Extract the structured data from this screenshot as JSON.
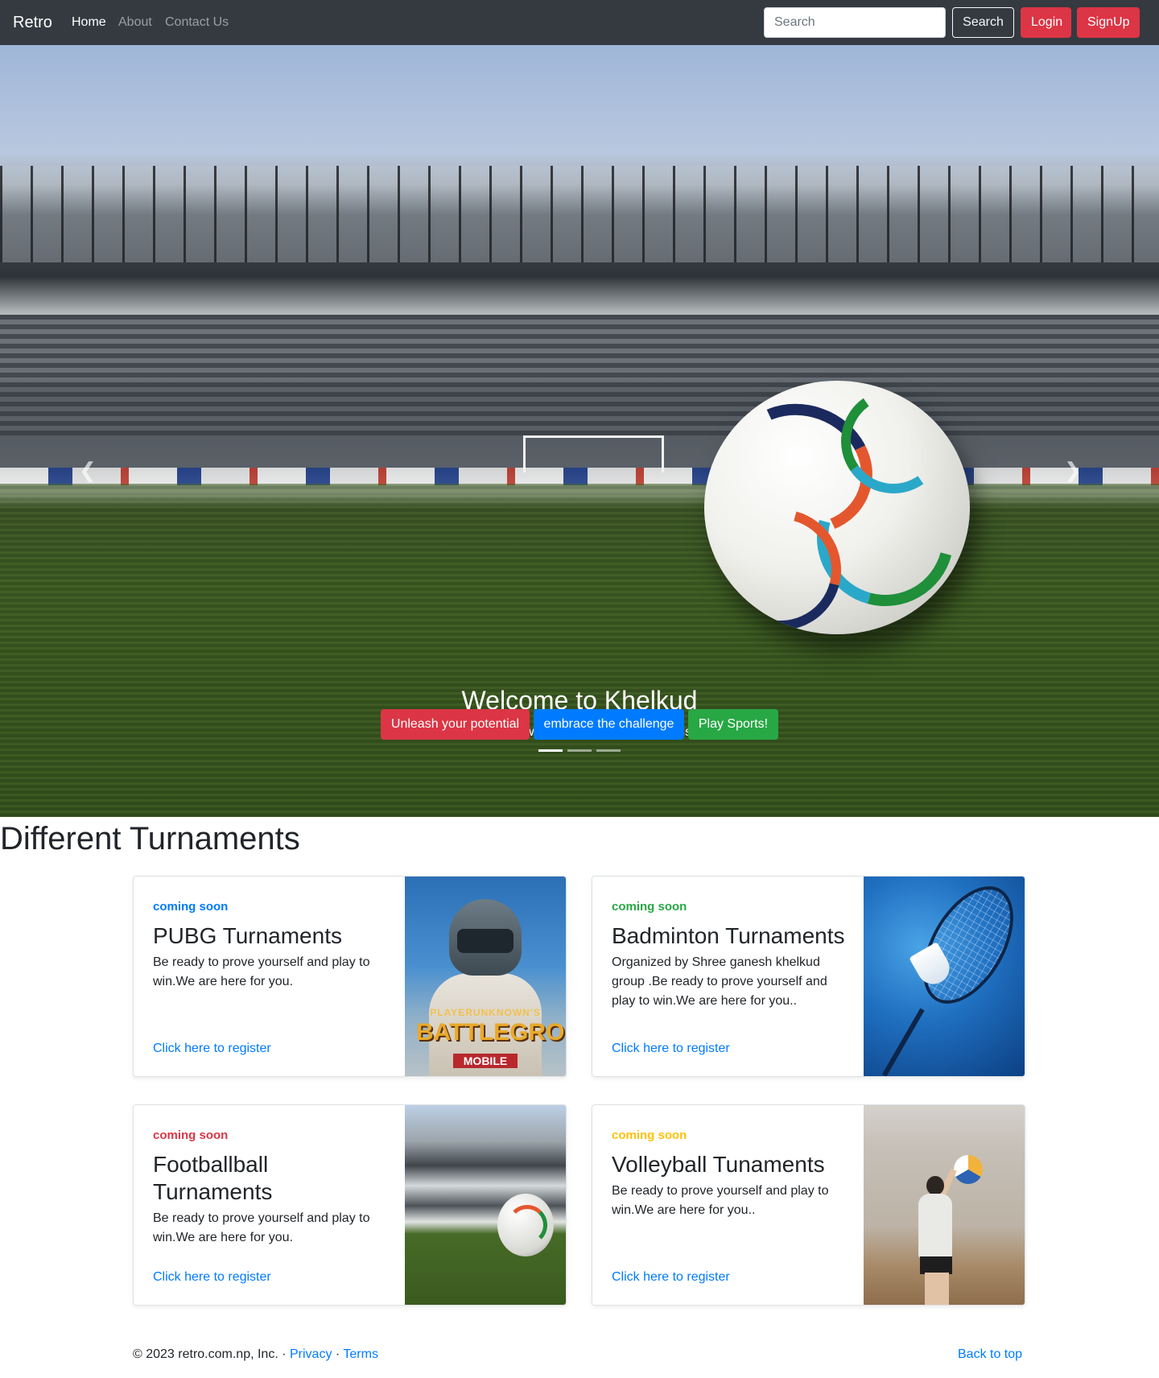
{
  "navbar": {
    "brand": "Retro",
    "links": [
      "Home",
      "About",
      "Contact Us"
    ],
    "search_placeholder": "Search",
    "search_button": "Search",
    "login_button": "Login",
    "signup_button": "SignUp",
    "colors": {
      "background": "#343a40",
      "danger": "#dc3545"
    }
  },
  "hero": {
    "title": "Welcome to Khelkud",
    "subtitle": "Sports News, Development and Trends",
    "buttons": [
      {
        "label": "Unleash your potential",
        "color": "#dc3545"
      },
      {
        "label": "embrace the challenge",
        "color": "#007bff"
      },
      {
        "label": "Play Sports!",
        "color": "#28a745"
      }
    ],
    "prev_icon": "chevron-left-icon",
    "next_icon": "chevron-right-icon",
    "slide_count": 3,
    "active_slide": 1
  },
  "section": {
    "title": "Different Turnaments",
    "cards": [
      {
        "tag": "coming soon",
        "tag_color": "#007bff",
        "title": "PUBG Turnaments",
        "text": "Be ready to prove yourself and play to win.We are here for you.",
        "link": "Click here to register",
        "image": "pubg-battlegrounds-image",
        "image_text": [
          "PLAYERUNKNOWN'S",
          "BATTLEGROUNDS",
          "MOBILE"
        ]
      },
      {
        "tag": "coming soon",
        "tag_color": "#28a745",
        "title": "Badminton Turnaments",
        "text": "Organized by Shree ganesh khelkud group .Be ready to prove yourself and play to win.We are here for you..",
        "link": "Click here to register",
        "image": "badminton-racket-image"
      },
      {
        "tag": "coming soon",
        "tag_color": "#dc3545",
        "title": "Footballball Turnaments",
        "text": "Be ready to prove yourself and play to win.We are here for you.",
        "link": "Click here to register",
        "image": "football-stadium-image"
      },
      {
        "tag": "coming soon",
        "tag_color": "#ffc107",
        "title": "Volleyball Tunaments",
        "text": "Be ready to prove yourself and play to win.We are here for you..",
        "link": "Click here to register",
        "image": "volleyball-player-image"
      }
    ]
  },
  "footer": {
    "copyright": "© 2023 retro.com.np, Inc. ·",
    "privacy": "Privacy",
    "separator": "·",
    "terms": "Terms",
    "back_to_top": "Back to top"
  }
}
